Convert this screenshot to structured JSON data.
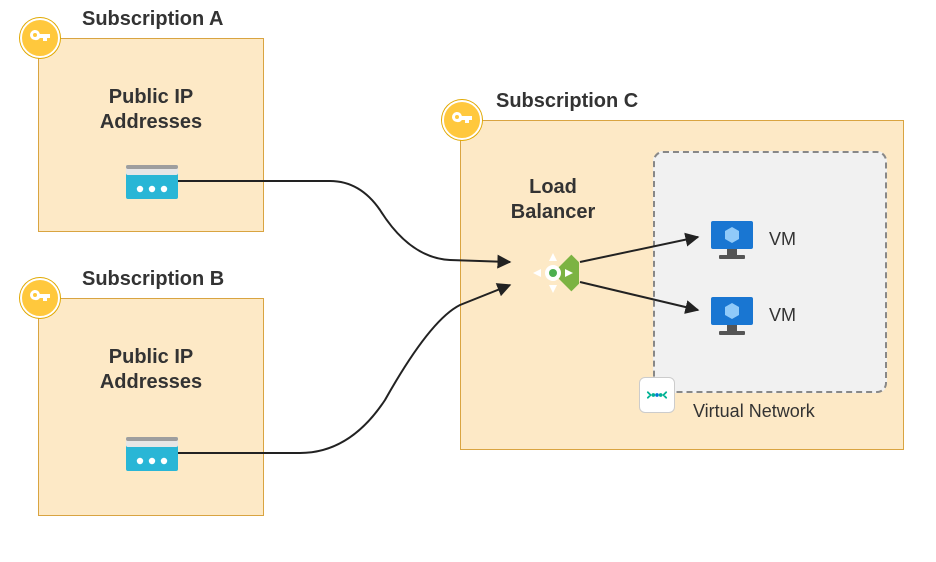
{
  "subscriptions": {
    "a": {
      "title": "Subscription A",
      "content_label": "Public IP\nAddresses"
    },
    "b": {
      "title": "Subscription B",
      "content_label": "Public IP\nAddresses"
    },
    "c": {
      "title": "Subscription C",
      "lb_label": "Load\nBalancer"
    }
  },
  "vnet": {
    "label": "Virtual Network",
    "vms": [
      {
        "label": "VM"
      },
      {
        "label": "VM"
      }
    ]
  },
  "icons": {
    "key": "key-icon",
    "public_ip": "public-ip-icon",
    "load_balancer": "load-balancer-icon",
    "vm": "vm-icon",
    "vnet": "vnet-icon"
  },
  "colors": {
    "subscription_bg": "#fde9c6",
    "subscription_border": "#d9a441",
    "vnet_bg": "#f1f1f1",
    "vnet_border": "#888888",
    "key_badge": "#ffc83d",
    "ip_blue": "#29b6d6",
    "lb_green": "#7cb342",
    "vm_blue": "#1976d2"
  }
}
